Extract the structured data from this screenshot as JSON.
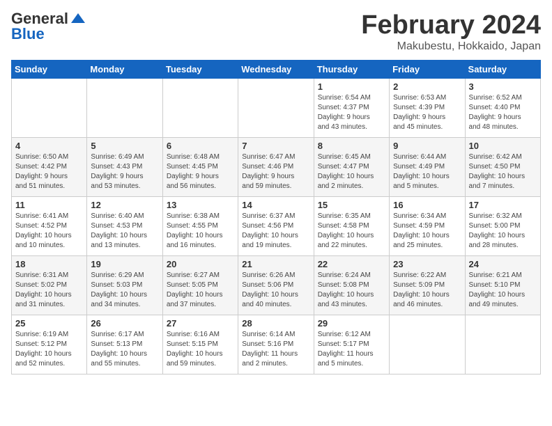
{
  "logo": {
    "general": "General",
    "blue": "Blue"
  },
  "title": "February 2024",
  "subtitle": "Makubestu, Hokkaido, Japan",
  "days_of_week": [
    "Sunday",
    "Monday",
    "Tuesday",
    "Wednesday",
    "Thursday",
    "Friday",
    "Saturday"
  ],
  "weeks": [
    [
      {
        "day": "",
        "info": ""
      },
      {
        "day": "",
        "info": ""
      },
      {
        "day": "",
        "info": ""
      },
      {
        "day": "",
        "info": ""
      },
      {
        "day": "1",
        "info": "Sunrise: 6:54 AM\nSunset: 4:37 PM\nDaylight: 9 hours\nand 43 minutes."
      },
      {
        "day": "2",
        "info": "Sunrise: 6:53 AM\nSunset: 4:39 PM\nDaylight: 9 hours\nand 45 minutes."
      },
      {
        "day": "3",
        "info": "Sunrise: 6:52 AM\nSunset: 4:40 PM\nDaylight: 9 hours\nand 48 minutes."
      }
    ],
    [
      {
        "day": "4",
        "info": "Sunrise: 6:50 AM\nSunset: 4:42 PM\nDaylight: 9 hours\nand 51 minutes."
      },
      {
        "day": "5",
        "info": "Sunrise: 6:49 AM\nSunset: 4:43 PM\nDaylight: 9 hours\nand 53 minutes."
      },
      {
        "day": "6",
        "info": "Sunrise: 6:48 AM\nSunset: 4:45 PM\nDaylight: 9 hours\nand 56 minutes."
      },
      {
        "day": "7",
        "info": "Sunrise: 6:47 AM\nSunset: 4:46 PM\nDaylight: 9 hours\nand 59 minutes."
      },
      {
        "day": "8",
        "info": "Sunrise: 6:45 AM\nSunset: 4:47 PM\nDaylight: 10 hours\nand 2 minutes."
      },
      {
        "day": "9",
        "info": "Sunrise: 6:44 AM\nSunset: 4:49 PM\nDaylight: 10 hours\nand 5 minutes."
      },
      {
        "day": "10",
        "info": "Sunrise: 6:42 AM\nSunset: 4:50 PM\nDaylight: 10 hours\nand 7 minutes."
      }
    ],
    [
      {
        "day": "11",
        "info": "Sunrise: 6:41 AM\nSunset: 4:52 PM\nDaylight: 10 hours\nand 10 minutes."
      },
      {
        "day": "12",
        "info": "Sunrise: 6:40 AM\nSunset: 4:53 PM\nDaylight: 10 hours\nand 13 minutes."
      },
      {
        "day": "13",
        "info": "Sunrise: 6:38 AM\nSunset: 4:55 PM\nDaylight: 10 hours\nand 16 minutes."
      },
      {
        "day": "14",
        "info": "Sunrise: 6:37 AM\nSunset: 4:56 PM\nDaylight: 10 hours\nand 19 minutes."
      },
      {
        "day": "15",
        "info": "Sunrise: 6:35 AM\nSunset: 4:58 PM\nDaylight: 10 hours\nand 22 minutes."
      },
      {
        "day": "16",
        "info": "Sunrise: 6:34 AM\nSunset: 4:59 PM\nDaylight: 10 hours\nand 25 minutes."
      },
      {
        "day": "17",
        "info": "Sunrise: 6:32 AM\nSunset: 5:00 PM\nDaylight: 10 hours\nand 28 minutes."
      }
    ],
    [
      {
        "day": "18",
        "info": "Sunrise: 6:31 AM\nSunset: 5:02 PM\nDaylight: 10 hours\nand 31 minutes."
      },
      {
        "day": "19",
        "info": "Sunrise: 6:29 AM\nSunset: 5:03 PM\nDaylight: 10 hours\nand 34 minutes."
      },
      {
        "day": "20",
        "info": "Sunrise: 6:27 AM\nSunset: 5:05 PM\nDaylight: 10 hours\nand 37 minutes."
      },
      {
        "day": "21",
        "info": "Sunrise: 6:26 AM\nSunset: 5:06 PM\nDaylight: 10 hours\nand 40 minutes."
      },
      {
        "day": "22",
        "info": "Sunrise: 6:24 AM\nSunset: 5:08 PM\nDaylight: 10 hours\nand 43 minutes."
      },
      {
        "day": "23",
        "info": "Sunrise: 6:22 AM\nSunset: 5:09 PM\nDaylight: 10 hours\nand 46 minutes."
      },
      {
        "day": "24",
        "info": "Sunrise: 6:21 AM\nSunset: 5:10 PM\nDaylight: 10 hours\nand 49 minutes."
      }
    ],
    [
      {
        "day": "25",
        "info": "Sunrise: 6:19 AM\nSunset: 5:12 PM\nDaylight: 10 hours\nand 52 minutes."
      },
      {
        "day": "26",
        "info": "Sunrise: 6:17 AM\nSunset: 5:13 PM\nDaylight: 10 hours\nand 55 minutes."
      },
      {
        "day": "27",
        "info": "Sunrise: 6:16 AM\nSunset: 5:15 PM\nDaylight: 10 hours\nand 59 minutes."
      },
      {
        "day": "28",
        "info": "Sunrise: 6:14 AM\nSunset: 5:16 PM\nDaylight: 11 hours\nand 2 minutes."
      },
      {
        "day": "29",
        "info": "Sunrise: 6:12 AM\nSunset: 5:17 PM\nDaylight: 11 hours\nand 5 minutes."
      },
      {
        "day": "",
        "info": ""
      },
      {
        "day": "",
        "info": ""
      }
    ]
  ]
}
